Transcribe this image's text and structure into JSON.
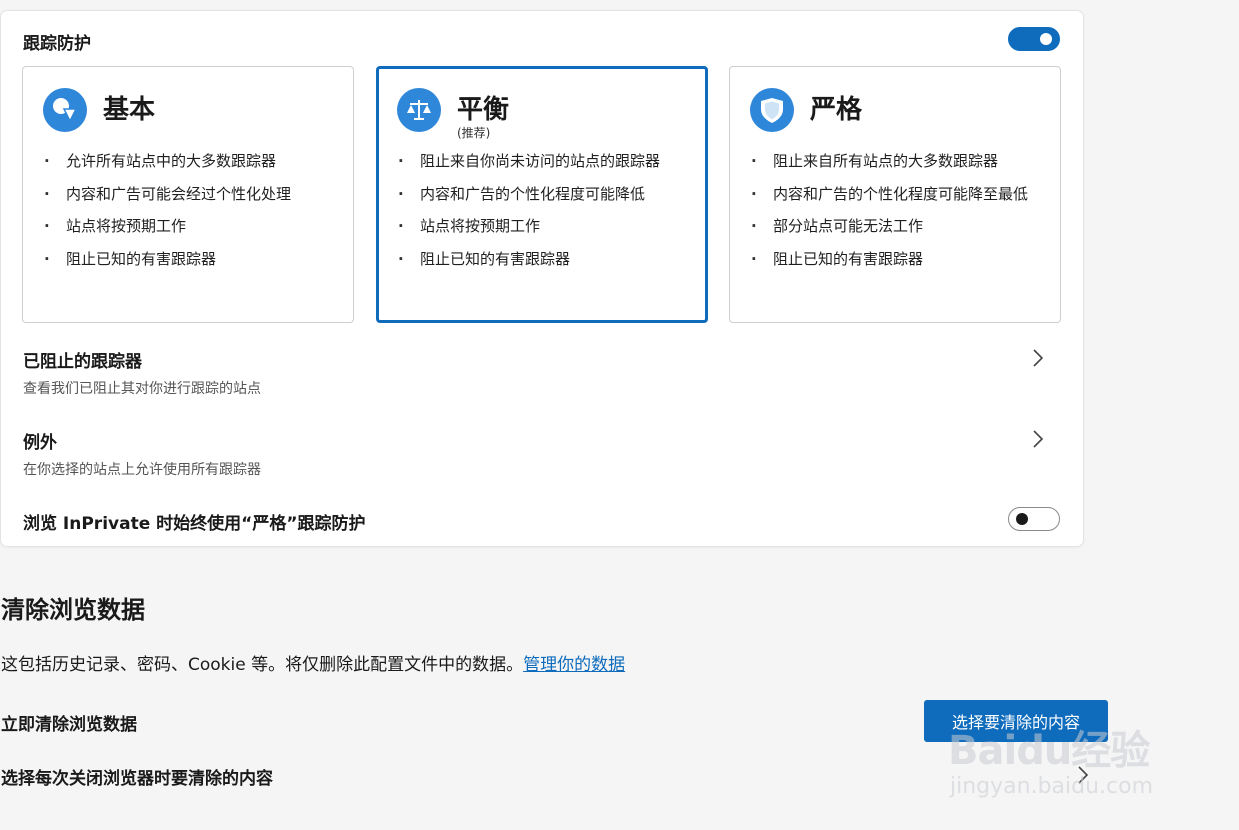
{
  "tracking": {
    "title": "跟踪防护",
    "enabled": true,
    "levels": [
      {
        "name": "基本",
        "subtitle": "",
        "icon": "shapes-icon",
        "selected": false,
        "items": [
          "允许所有站点中的大多数跟踪器",
          "内容和广告可能会经过个性化处理",
          "站点将按预期工作",
          "阻止已知的有害跟踪器"
        ]
      },
      {
        "name": "平衡",
        "subtitle": "(推荐)",
        "icon": "scales-icon",
        "selected": true,
        "items": [
          "阻止来自你尚未访问的站点的跟踪器",
          "内容和广告的个性化程度可能降低",
          "站点将按预期工作",
          "阻止已知的有害跟踪器"
        ]
      },
      {
        "name": "严格",
        "subtitle": "",
        "icon": "shield-icon",
        "selected": false,
        "items": [
          "阻止来自所有站点的大多数跟踪器",
          "内容和广告的个性化程度可能降至最低",
          "部分站点可能无法工作",
          "阻止已知的有害跟踪器"
        ]
      }
    ],
    "blocked": {
      "title": "已阻止的跟踪器",
      "desc": "查看我们已阻止其对你进行跟踪的站点"
    },
    "exceptions": {
      "title": "例外",
      "desc": "在你选择的站点上允许使用所有跟踪器"
    },
    "inprivate": {
      "label": "浏览 InPrivate 时始终使用“严格”跟踪防护",
      "enabled": false
    }
  },
  "clear": {
    "title": "清除浏览数据",
    "desc": "这包括历史记录、密码、Cookie 等。将仅删除此配置文件中的数据。",
    "manage_link": "管理你的数据",
    "now_label": "立即清除浏览数据",
    "choose_button": "选择要清除的内容",
    "on_close_label": "选择每次关闭浏览器时要清除的内容"
  },
  "watermark": {
    "logo": "Baidu经验",
    "url": "jingyan.baidu.com"
  },
  "colors": {
    "accent": "#0f6cbd",
    "icon_blue": "#2f87d9",
    "background": "#f5f5f5"
  }
}
